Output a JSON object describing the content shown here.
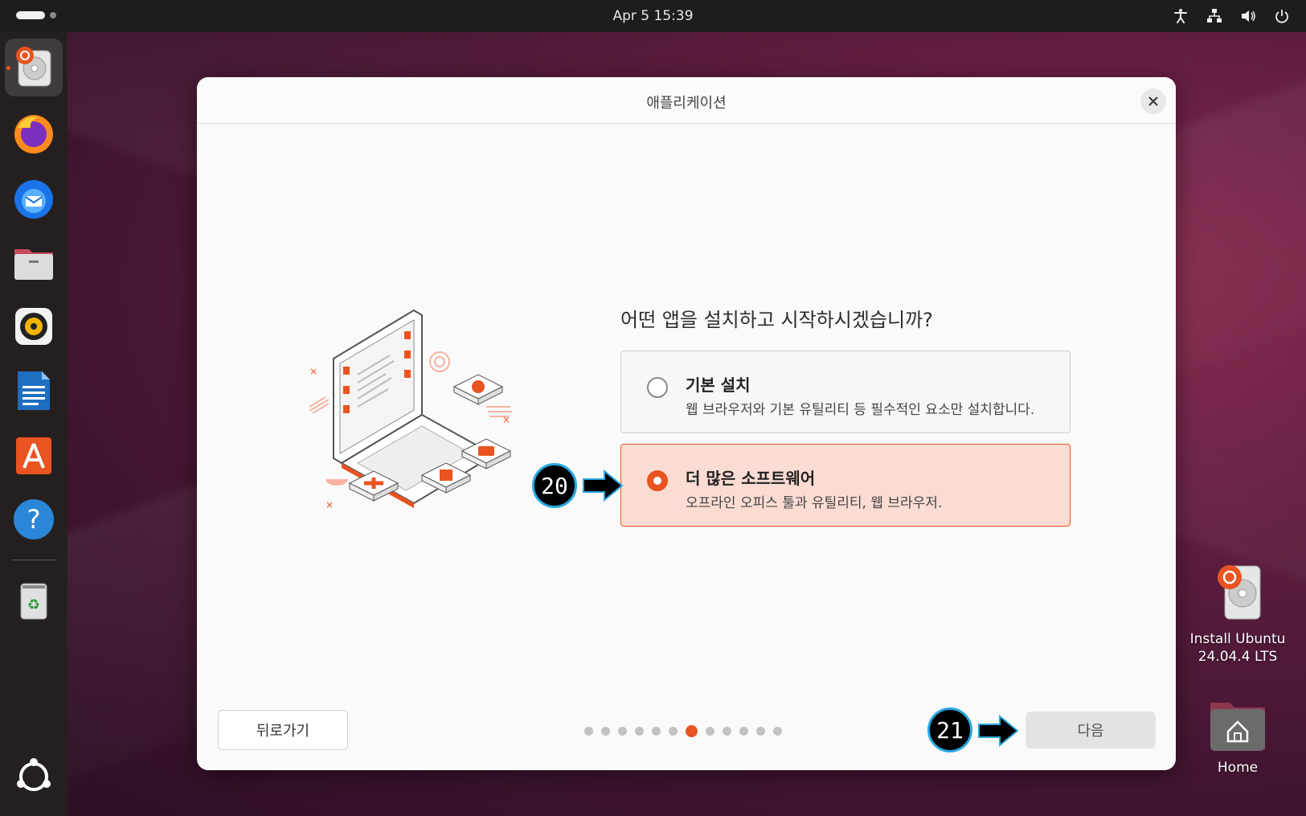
{
  "topbar": {
    "clock": "Apr 5  15:39"
  },
  "dock": {
    "items": [
      "installer",
      "firefox",
      "thunderbird",
      "files",
      "rhythmbox",
      "libreoffice-writer",
      "app-center",
      "help",
      "trash",
      "show-apps"
    ]
  },
  "desktop": {
    "install_label_line1": "Install Ubuntu",
    "install_label_line2": "24.04.4 LTS",
    "home_label": "Home"
  },
  "dialog": {
    "title": "애플리케이션",
    "question": "어떤 앱을 설치하고 시작하시겠습니까?",
    "options": [
      {
        "title": "기본 설치",
        "desc": "웹 브라우저와 기본 유틸리티 등 필수적인 요소만 설치합니다.",
        "selected": false
      },
      {
        "title": "더 많은 소프트웨어",
        "desc": "오프라인 오피스 툴과 유틸리티, 웹 브라우저.",
        "selected": true
      }
    ],
    "back_label": "뒤로가기",
    "next_label": "다음",
    "progress": {
      "total": 12,
      "current": 7
    }
  },
  "annotations": {
    "step_a": "20",
    "step_b": "21"
  },
  "colors": {
    "accent": "#e95420",
    "selected_bg": "#fbdcd3",
    "annotation_ring": "#2aa7e0"
  }
}
